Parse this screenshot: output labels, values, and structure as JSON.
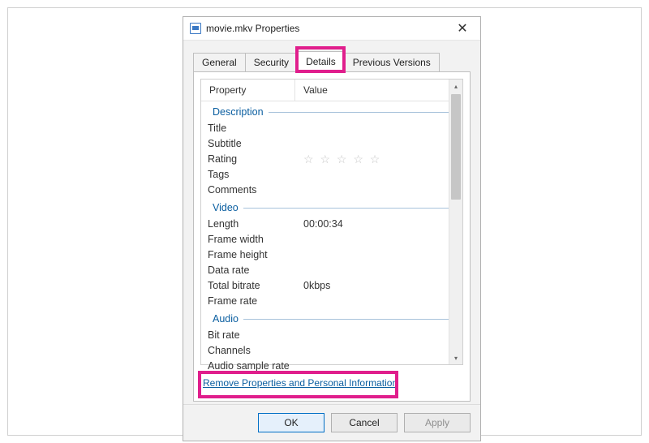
{
  "window": {
    "title": "movie.mkv Properties",
    "file_icon_name": "file-icon",
    "close_icon_name": "close-icon"
  },
  "tabs": {
    "general": "General",
    "security": "Security",
    "details": "Details",
    "previous_versions": "Previous Versions",
    "active": "details"
  },
  "columns": {
    "property": "Property",
    "value": "Value"
  },
  "groups": [
    {
      "name": "Description",
      "rows": [
        {
          "label": "Title",
          "value": ""
        },
        {
          "label": "Subtitle",
          "value": ""
        },
        {
          "label": "Rating",
          "value": "★★★★★",
          "is_rating": true
        },
        {
          "label": "Tags",
          "value": ""
        },
        {
          "label": "Comments",
          "value": ""
        }
      ]
    },
    {
      "name": "Video",
      "rows": [
        {
          "label": "Length",
          "value": "00:00:34"
        },
        {
          "label": "Frame width",
          "value": ""
        },
        {
          "label": "Frame height",
          "value": ""
        },
        {
          "label": "Data rate",
          "value": ""
        },
        {
          "label": "Total bitrate",
          "value": "0kbps"
        },
        {
          "label": "Frame rate",
          "value": ""
        }
      ]
    },
    {
      "name": "Audio",
      "rows": [
        {
          "label": "Bit rate",
          "value": ""
        },
        {
          "label": "Channels",
          "value": ""
        },
        {
          "label": "Audio sample rate",
          "value": ""
        }
      ]
    }
  ],
  "link": {
    "remove": "Remove Properties and Personal Information"
  },
  "buttons": {
    "ok": "OK",
    "cancel": "Cancel",
    "apply": "Apply"
  },
  "scroll_arrows": {
    "up": "▴",
    "down": "▾"
  },
  "highlight_color": "#e01e8c"
}
